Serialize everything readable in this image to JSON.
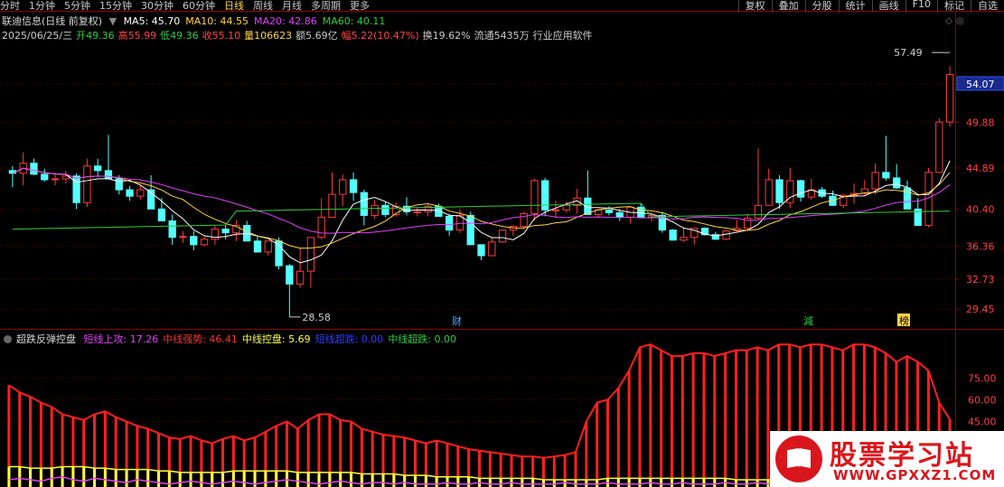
{
  "toolbar": {
    "periods": [
      "分时",
      "1分钟",
      "5分钟",
      "15分钟",
      "30分钟",
      "60分钟",
      "日线",
      "周线",
      "月线",
      "多周期",
      "更多"
    ],
    "active_period": "日线",
    "right_buttons": [
      "复权",
      "叠加",
      "分股",
      "统计",
      "画线",
      "F10",
      "标记",
      "自选"
    ]
  },
  "header": {
    "title": "联迪信息(日线 前复权)",
    "ma": [
      {
        "label": "MA5: 45.70",
        "color": "#ffffff"
      },
      {
        "label": "MA10: 44.55",
        "color": "#ffd34a"
      },
      {
        "label": "MA20: 42.86",
        "color": "#e040fb"
      },
      {
        "label": "MA60: 40.11",
        "color": "#2ecc40"
      }
    ],
    "info": [
      {
        "text": "2025/06/25/三",
        "color": "#cccccc"
      },
      {
        "text": "开49.36",
        "color": "#2ecc40"
      },
      {
        "text": "高55.99",
        "color": "#ff4444"
      },
      {
        "text": "低49.36",
        "color": "#2ecc40"
      },
      {
        "text": "收55.10",
        "color": "#ff4444"
      },
      {
        "text": "量106623",
        "color": "#ffd34a"
      },
      {
        "text": "额5.69亿",
        "color": "#cccccc"
      },
      {
        "text": "幅5.22(10.47%)",
        "color": "#ff4444"
      },
      {
        "text": "换19.62%",
        "color": "#cccccc"
      },
      {
        "text": "流通5435万",
        "color": "#cccccc"
      },
      {
        "text": "行业应用软件",
        "color": "#cccccc"
      }
    ]
  },
  "price_axis": {
    "ticks": [
      "54.07",
      "49.88",
      "44.89",
      "40.40",
      "36.36",
      "32.73",
      "29.45"
    ],
    "current": "54.07"
  },
  "annotations": {
    "high": "57.49",
    "low": "28.58",
    "markers": [
      "财",
      "減",
      "榜"
    ]
  },
  "indicator": {
    "name": "超跌反弹控盘",
    "items": [
      {
        "text": "短线上攻: 17.26",
        "color": "#e040fb"
      },
      {
        "text": "中线强势: 46.41",
        "color": "#ff3030"
      },
      {
        "text": "中线控盘: 5.69",
        "color": "#ffff40"
      },
      {
        "text": "短线超跌: 0.00",
        "color": "#2f3fff"
      },
      {
        "text": "中线超跌: 0.00",
        "color": "#2ecc40"
      }
    ],
    "ticks": [
      "75.00",
      "60.00",
      "45.00"
    ]
  },
  "chart_data": {
    "type": "candlestick",
    "ylim": [
      27.5,
      58.5
    ],
    "candles": [
      [
        44.6,
        45.1,
        42.8,
        44.3
      ],
      [
        44.3,
        46.6,
        43.0,
        45.4
      ],
      [
        45.4,
        45.9,
        44.1,
        44.2
      ],
      [
        44.2,
        44.8,
        43.4,
        43.6
      ],
      [
        43.6,
        44.4,
        43.0,
        43.7
      ],
      [
        43.7,
        44.6,
        43.2,
        44.0
      ],
      [
        44.0,
        44.3,
        40.4,
        41.1
      ],
      [
        41.1,
        45.9,
        40.6,
        45.1
      ],
      [
        45.1,
        45.9,
        43.9,
        44.6
      ],
      [
        44.6,
        48.5,
        43.7,
        43.7
      ],
      [
        43.7,
        44.1,
        42.0,
        42.5
      ],
      [
        42.5,
        42.9,
        41.3,
        41.8
      ],
      [
        41.8,
        43.1,
        41.4,
        42.5
      ],
      [
        42.5,
        44.1,
        40.4,
        40.4
      ],
      [
        40.4,
        41.6,
        39.1,
        39.1
      ],
      [
        39.1,
        39.8,
        36.5,
        37.3
      ],
      [
        37.3,
        38.0,
        36.7,
        37.4
      ],
      [
        37.4,
        38.0,
        35.9,
        36.5
      ],
      [
        36.5,
        37.5,
        36.3,
        37.1
      ],
      [
        37.1,
        38.6,
        36.5,
        38.2
      ],
      [
        38.2,
        38.7,
        37.1,
        37.8
      ],
      [
        37.8,
        39.2,
        36.9,
        38.6
      ],
      [
        38.6,
        39.1,
        36.9,
        36.9
      ],
      [
        36.9,
        37.4,
        35.7,
        35.7
      ],
      [
        35.7,
        36.9,
        35.3,
        36.9
      ],
      [
        36.9,
        37.3,
        33.8,
        34.2
      ],
      [
        34.2,
        34.4,
        28.6,
        32.2
      ],
      [
        32.2,
        36.2,
        31.8,
        33.6
      ],
      [
        33.6,
        36.7,
        31.8,
        37.3
      ],
      [
        37.3,
        41.6,
        37.1,
        39.5
      ],
      [
        39.5,
        44.4,
        39.5,
        42.0
      ],
      [
        42.0,
        44.2,
        40.7,
        43.6
      ],
      [
        43.6,
        44.4,
        41.3,
        42.2
      ],
      [
        42.2,
        42.5,
        38.6,
        39.7
      ],
      [
        39.7,
        41.4,
        39.3,
        40.8
      ],
      [
        40.8,
        41.2,
        39.5,
        39.8
      ],
      [
        39.8,
        41.1,
        39.6,
        40.7
      ],
      [
        40.7,
        41.7,
        39.7,
        40.1
      ],
      [
        40.1,
        40.6,
        39.6,
        40.1
      ],
      [
        40.1,
        41.0,
        39.6,
        40.7
      ],
      [
        40.7,
        41.0,
        39.6,
        39.6
      ],
      [
        39.6,
        39.9,
        37.5,
        38.1
      ],
      [
        38.1,
        40.4,
        37.8,
        39.7
      ],
      [
        39.7,
        40.1,
        36.5,
        36.5
      ],
      [
        36.5,
        36.5,
        34.8,
        35.3
      ],
      [
        35.3,
        37.3,
        35.3,
        36.8
      ],
      [
        36.8,
        38.1,
        36.7,
        38.1
      ],
      [
        38.1,
        38.6,
        37.5,
        38.5
      ],
      [
        38.5,
        40.1,
        38.2,
        39.9
      ],
      [
        39.9,
        43.7,
        39.1,
        43.5
      ],
      [
        43.5,
        43.8,
        39.6,
        40.3
      ],
      [
        40.3,
        41.3,
        39.4,
        40.3
      ],
      [
        40.3,
        41.2,
        40.0,
        40.8
      ],
      [
        40.8,
        42.6,
        39.9,
        41.6
      ],
      [
        41.6,
        44.6,
        39.8,
        39.8
      ],
      [
        39.8,
        40.4,
        39.4,
        40.3
      ],
      [
        40.3,
        40.7,
        39.7,
        40.0
      ],
      [
        40.0,
        40.4,
        39.1,
        39.5
      ],
      [
        39.5,
        40.6,
        38.8,
        40.6
      ],
      [
        40.6,
        41.0,
        39.5,
        39.5
      ],
      [
        39.5,
        40.0,
        39.0,
        39.7
      ],
      [
        39.7,
        40.1,
        37.8,
        38.1
      ],
      [
        38.1,
        38.2,
        37.0,
        37.0
      ],
      [
        37.0,
        38.3,
        36.8,
        37.3
      ],
      [
        37.3,
        38.3,
        36.5,
        38.3
      ],
      [
        38.3,
        38.4,
        37.5,
        37.6
      ],
      [
        37.6,
        37.9,
        37.0,
        37.1
      ],
      [
        37.1,
        38.1,
        37.0,
        38.0
      ],
      [
        38.0,
        39.2,
        37.9,
        38.3
      ],
      [
        38.3,
        39.9,
        38.1,
        39.4
      ],
      [
        39.4,
        47.0,
        39.2,
        40.8
      ],
      [
        40.8,
        44.8,
        40.8,
        43.6
      ],
      [
        43.6,
        44.1,
        40.4,
        41.1
      ],
      [
        41.1,
        44.9,
        40.5,
        43.5
      ],
      [
        43.5,
        43.6,
        41.2,
        41.7
      ],
      [
        41.7,
        43.7,
        41.4,
        42.5
      ],
      [
        42.5,
        42.8,
        41.6,
        41.8
      ],
      [
        41.8,
        42.4,
        40.8,
        40.8
      ],
      [
        40.8,
        42.0,
        40.5,
        41.9
      ],
      [
        41.9,
        43.2,
        41.0,
        42.1
      ],
      [
        42.1,
        43.6,
        41.8,
        42.6
      ],
      [
        42.6,
        45.4,
        42.0,
        44.4
      ],
      [
        44.4,
        48.4,
        43.5,
        43.8
      ],
      [
        43.8,
        45.3,
        42.6,
        42.7
      ],
      [
        42.7,
        43.5,
        40.4,
        40.4
      ],
      [
        40.4,
        41.6,
        38.6,
        38.6
      ],
      [
        38.6,
        44.9,
        38.4,
        44.4
      ],
      [
        44.4,
        50.3,
        44.3,
        49.9
      ],
      [
        49.9,
        56.0,
        49.4,
        55.1
      ]
    ],
    "ma_lines": [
      "MA5",
      "MA10",
      "MA20",
      "MA60"
    ],
    "indicator_series": {
      "short_attack": [
        5,
        6,
        5,
        4,
        6,
        7,
        5,
        4,
        6,
        5,
        4,
        3,
        5,
        4,
        3,
        2,
        3,
        4,
        3,
        2,
        3,
        4,
        3,
        2,
        3,
        4,
        5,
        4,
        3,
        2,
        3,
        4,
        3,
        2,
        3,
        3,
        2,
        3,
        2,
        2,
        2,
        3,
        2,
        2,
        3,
        2,
        2,
        3,
        2,
        2,
        2,
        2,
        3,
        2,
        2,
        2,
        3,
        2,
        2,
        2,
        3,
        2,
        2,
        3,
        2,
        2,
        2,
        3,
        2,
        2,
        3,
        2,
        2,
        2,
        3,
        2,
        2,
        3,
        2,
        2,
        2,
        8,
        3,
        2,
        3,
        2,
        3,
        10,
        17.26
      ],
      "mid_strong": [
        70,
        65,
        62,
        58,
        55,
        50,
        48,
        46,
        50,
        52,
        48,
        45,
        42,
        40,
        37,
        34,
        33,
        35,
        32,
        30,
        33,
        35,
        32,
        34,
        38,
        42,
        45,
        40,
        46,
        50,
        50,
        46,
        45,
        40,
        38,
        36,
        35,
        34,
        32,
        30,
        32,
        30,
        28,
        26,
        25,
        24,
        23,
        22,
        21,
        21,
        20,
        21,
        22,
        24,
        45,
        58,
        60,
        68,
        80,
        96,
        98,
        94,
        90,
        90,
        92,
        92,
        90,
        92,
        94,
        94,
        96,
        94,
        98,
        98,
        96,
        98,
        98,
        96,
        94,
        98,
        98,
        96,
        92,
        86,
        90,
        86,
        80,
        58,
        46.41
      ],
      "mid_control": [
        14,
        14,
        13,
        13,
        13,
        14,
        14,
        14,
        13,
        13,
        12,
        12,
        12,
        12,
        11,
        11,
        10,
        10,
        10,
        10,
        10,
        11,
        11,
        11,
        11,
        11,
        11,
        10,
        10,
        10,
        10,
        10,
        10,
        9,
        9,
        9,
        9,
        8,
        8,
        8,
        7,
        7,
        7,
        7,
        6,
        6,
        6,
        6,
        6,
        6,
        5,
        5,
        5,
        5,
        5,
        5,
        6,
        6,
        6,
        6,
        6,
        6,
        6,
        6,
        6,
        6,
        6,
        6,
        5,
        5,
        5,
        5,
        5,
        5,
        5,
        5,
        5,
        5,
        5,
        5,
        5,
        5,
        5,
        5,
        5,
        5,
        5,
        5,
        5.69
      ]
    }
  }
}
